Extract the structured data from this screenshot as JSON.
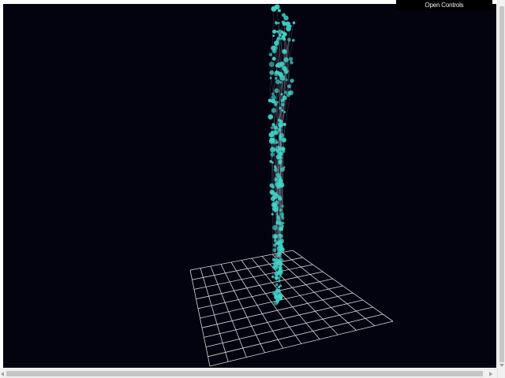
{
  "controls": {
    "open_controls_label": "Open Controls"
  },
  "scene": {
    "background_color": "#03020f",
    "grid_color": "#d8d8d8",
    "node_color": "#41d4c8",
    "edge_color": "#9fa8b8"
  },
  "icons": {
    "scroll_left": "arrow-left-icon",
    "scroll_right": "arrow-right-icon",
    "scroll_down": "arrow-down-icon"
  }
}
